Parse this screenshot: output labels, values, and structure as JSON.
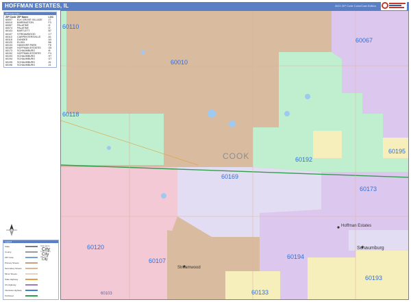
{
  "header": {
    "title": "HOFFMAN ESTATES, IL",
    "edition": "2022 ZIP Code Color/Cast Edition"
  },
  "zip_index": {
    "heading": "ZIP Code Index",
    "columns": [
      "ZIP Code",
      "ZIP Name",
      "LOC"
    ],
    "rows": [
      [
        "60007",
        "ELK GROVE VILLAGE",
        "J7"
      ],
      [
        "60010",
        "BARRINGTON",
        "F3"
      ],
      [
        "60067",
        "PALATINE",
        "I2"
      ],
      [
        "60074",
        "PALATINE",
        "I2"
      ],
      [
        "60103",
        "BARTLETT",
        "B7"
      ],
      [
        "60107",
        "STREAMWOOD",
        "C7"
      ],
      [
        "60110",
        "CARPENTERSVILLE",
        "A1"
      ],
      [
        "60118",
        "DUNDEE",
        "A3"
      ],
      [
        "60120",
        "ELGIN",
        "B6"
      ],
      [
        "60133",
        "HANOVER PARK",
        "F8"
      ],
      [
        "60169",
        "HOFFMAN ESTATES",
        "G5"
      ],
      [
        "60173",
        "SCHAUMBURG",
        "I6"
      ],
      [
        "60192",
        "HOFFMAN ESTATES",
        "F4"
      ],
      [
        "60193",
        "SCHAUMBURG",
        "H7"
      ],
      [
        "60194",
        "SCHAUMBURG",
        "G7"
      ],
      [
        "60195",
        "SCHAUMBURG",
        "J6"
      ],
      [
        "60196",
        "SCHAUMBURG",
        "J4"
      ]
    ]
  },
  "legend": {
    "heading": "Legend",
    "rows": [
      {
        "label": "State",
        "sample": "State Name",
        "color": "#7a7a7a"
      },
      {
        "label": "County",
        "sample": "Cook County",
        "color": "#9a9a9a"
      },
      {
        "label": "ZIP Code",
        "sample": "ZIP Code",
        "color": "#6fa0de"
      },
      {
        "label": "Primary Streets",
        "sample": "",
        "color": "#c8a080"
      },
      {
        "label": "Secondary Streets",
        "sample": "",
        "color": "#d6b69a"
      },
      {
        "label": "Minor Streets",
        "sample": "",
        "color": "#e6d0be"
      },
      {
        "label": "State Highway",
        "sample": "",
        "color": "#e0a040"
      },
      {
        "label": "US Highway",
        "sample": "",
        "color": "#9a7ac0"
      },
      {
        "label": "Interstate Highway",
        "sample": "",
        "color": "#3b7fd1"
      },
      {
        "label": "Toll Road",
        "sample": "",
        "color": "#2e9e4a"
      }
    ],
    "city_samples": [
      "City",
      "City",
      "City"
    ]
  },
  "map": {
    "county_label": "COOK",
    "zip_labels": [
      {
        "zip": "60110"
      },
      {
        "zip": "60010"
      },
      {
        "zip": "60067"
      },
      {
        "zip": "60118"
      },
      {
        "zip": "60195"
      },
      {
        "zip": "60192"
      },
      {
        "zip": "60169"
      },
      {
        "zip": "60173"
      },
      {
        "zip": "60120"
      },
      {
        "zip": "60107"
      },
      {
        "zip": "60194"
      },
      {
        "zip": "60193"
      },
      {
        "zip": "60133"
      },
      {
        "zip": "60103"
      }
    ],
    "city_labels": [
      "Hoffman Estates",
      "Schaumburg",
      "Streamwood"
    ]
  },
  "colors": {
    "title_bar": "#5a7fc4",
    "zip_text": "#2f6fd6",
    "tan": "#d9bba0",
    "green": "#bfefcf",
    "purple": "#dcc8ee",
    "lavender": "#e3ddf3",
    "pink": "#f3c9d6",
    "yellow": "#f6eebb",
    "toll_road": "#2e9e4a"
  }
}
